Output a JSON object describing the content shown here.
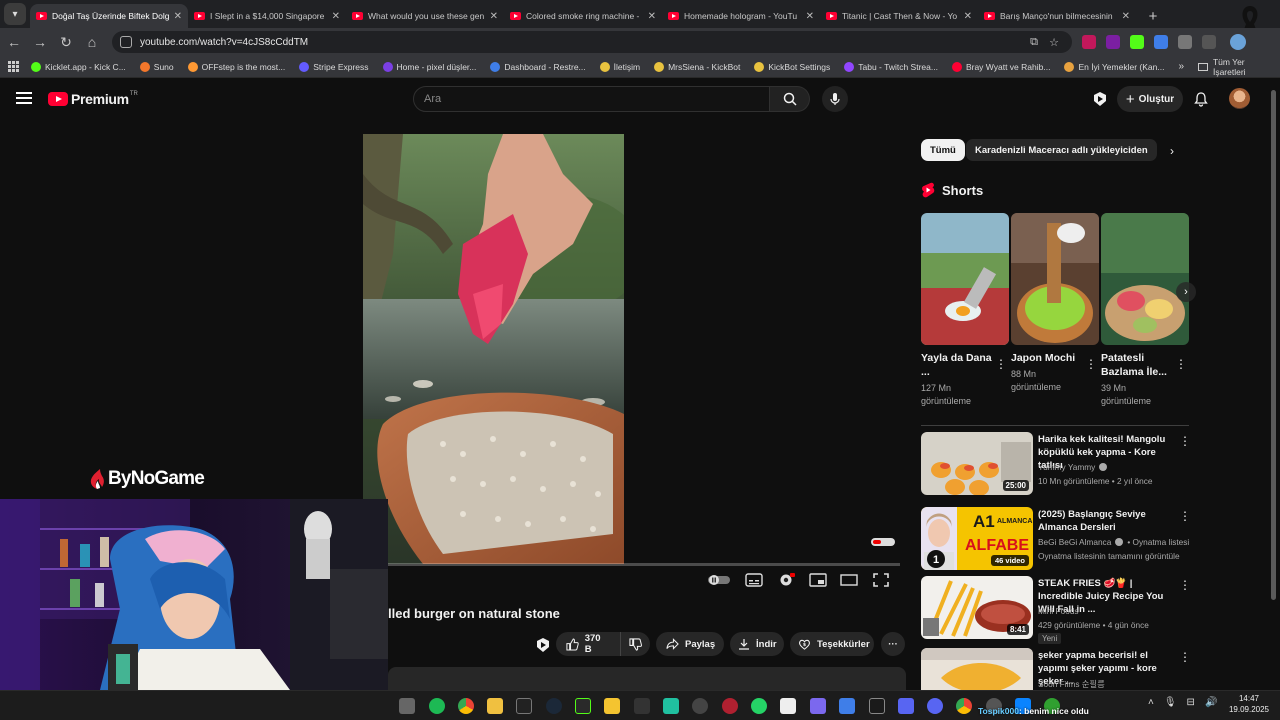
{
  "browser": {
    "tabs": [
      {
        "title": "Doğal Taş Üzerinde Biftek Dolg",
        "active": true
      },
      {
        "title": "I Slept in a $14,000 Singapore",
        "active": false
      },
      {
        "title": "What would you use these gen",
        "active": false
      },
      {
        "title": "Colored smoke ring machine -",
        "active": false
      },
      {
        "title": "Homemade hologram - YouTu",
        "active": false
      },
      {
        "title": "Titanic | Cast Then & Now - Yo",
        "active": false
      },
      {
        "title": "Barış Manço'nun bilmecesinin",
        "active": false
      }
    ],
    "url": "youtube.com/watch?v=4cJS8cCddTM",
    "bookmarks": [
      {
        "label": "Kicklet.app - Kick C...",
        "color": "#53fc18"
      },
      {
        "label": "Suno",
        "color": "#f4772b"
      },
      {
        "label": "OFFstep is the most...",
        "color": "#ff9933"
      },
      {
        "label": "Stripe Express",
        "color": "#635bff"
      },
      {
        "label": "Home - pixel düşler...",
        "color": "#7b3fe4"
      },
      {
        "label": "Dashboard - Restre...",
        "color": "#3f7ee8"
      },
      {
        "label": "İletişim",
        "color": "#e8c23f"
      },
      {
        "label": "MrsSiena - KickBot",
        "color": "#e8c23f"
      },
      {
        "label": "KickBot Settings",
        "color": "#e8c23f"
      },
      {
        "label": "Tabu - Twitch Strea...",
        "color": "#9146ff"
      },
      {
        "label": "Bray Wyatt ve Rahib...",
        "color": "#ff0033"
      },
      {
        "label": "En İyi Yemekler (Kan...",
        "color": "#e8a23f"
      }
    ],
    "bookmarks_more": "»",
    "all_bookmarks": "Tüm Yer İşaretleri"
  },
  "youtube": {
    "logo_word": "Premium",
    "logo_region": "TR",
    "search_placeholder": "Ara",
    "create_label": "Oluştur",
    "video_title": "lled burger on natural stone",
    "likes": "370 B",
    "share_label": "Paylaş",
    "download_label": "İndir",
    "thanks_label": "Teşekkürler",
    "progress_fraction": 0.0
  },
  "overlay": {
    "stream_logo": "ByNoGame",
    "chat_user": "Tospik000",
    "chat_message": ": benim nice oldu"
  },
  "sidebar": {
    "chips": [
      "Tümü",
      "Karadenizli Maceracı adlı yükleyiciden"
    ],
    "shorts_heading": "Shorts",
    "shorts": [
      {
        "title": "Yayla da Dana ...",
        "views": "127 Mn görüntüleme"
      },
      {
        "title": "Japon Mochi",
        "views": "88 Mn görüntüleme"
      },
      {
        "title": "Patatesli Bazlama İle...",
        "views": "39 Mn görüntüleme"
      }
    ],
    "recommendations": [
      {
        "title": "Harika kek kalitesi! Mangolu köpüklü kek yapma - Kore tatlısı",
        "channel": "Yummy Yammy",
        "verified": true,
        "meta": "10 Mn görüntüleme • 2 yıl önce",
        "duration": "25:00"
      },
      {
        "title": "(2025) Başlangıç Seviye Almanca Dersleri",
        "channel": "BeGi BeGi Almanca",
        "verified": true,
        "channel_suffix": "• Oynatma listesi",
        "meta": "Oynatma listesinin tamamını görüntüle",
        "playlist_count": "46 video",
        "thumb_text_1": "A1",
        "thumb_text_2": "ALMANCA",
        "thumb_text_3": "ALFABE",
        "thumb_number": "1"
      },
      {
        "title": "STEAK FRIES 🥩🍟 | Incredible Juicy Recipe You Will Fall in ...",
        "channel": "Mini Foods",
        "verified": false,
        "meta": "429 görüntüleme • 4 gün önce",
        "duration": "8:41",
        "badge": "Yeni"
      },
      {
        "title": "şeker yapma becerisi! el yapımı şeker yapımı - kore şeker ...",
        "channel": "Soon Films 순필름",
        "verified": false,
        "meta": ""
      }
    ]
  },
  "taskbar": {
    "time": "14:47",
    "date": "19.09.2025"
  },
  "colors": {
    "youtube_red": "#ff0033",
    "bg": "#0f0f0f",
    "chip_bg": "#272727"
  }
}
